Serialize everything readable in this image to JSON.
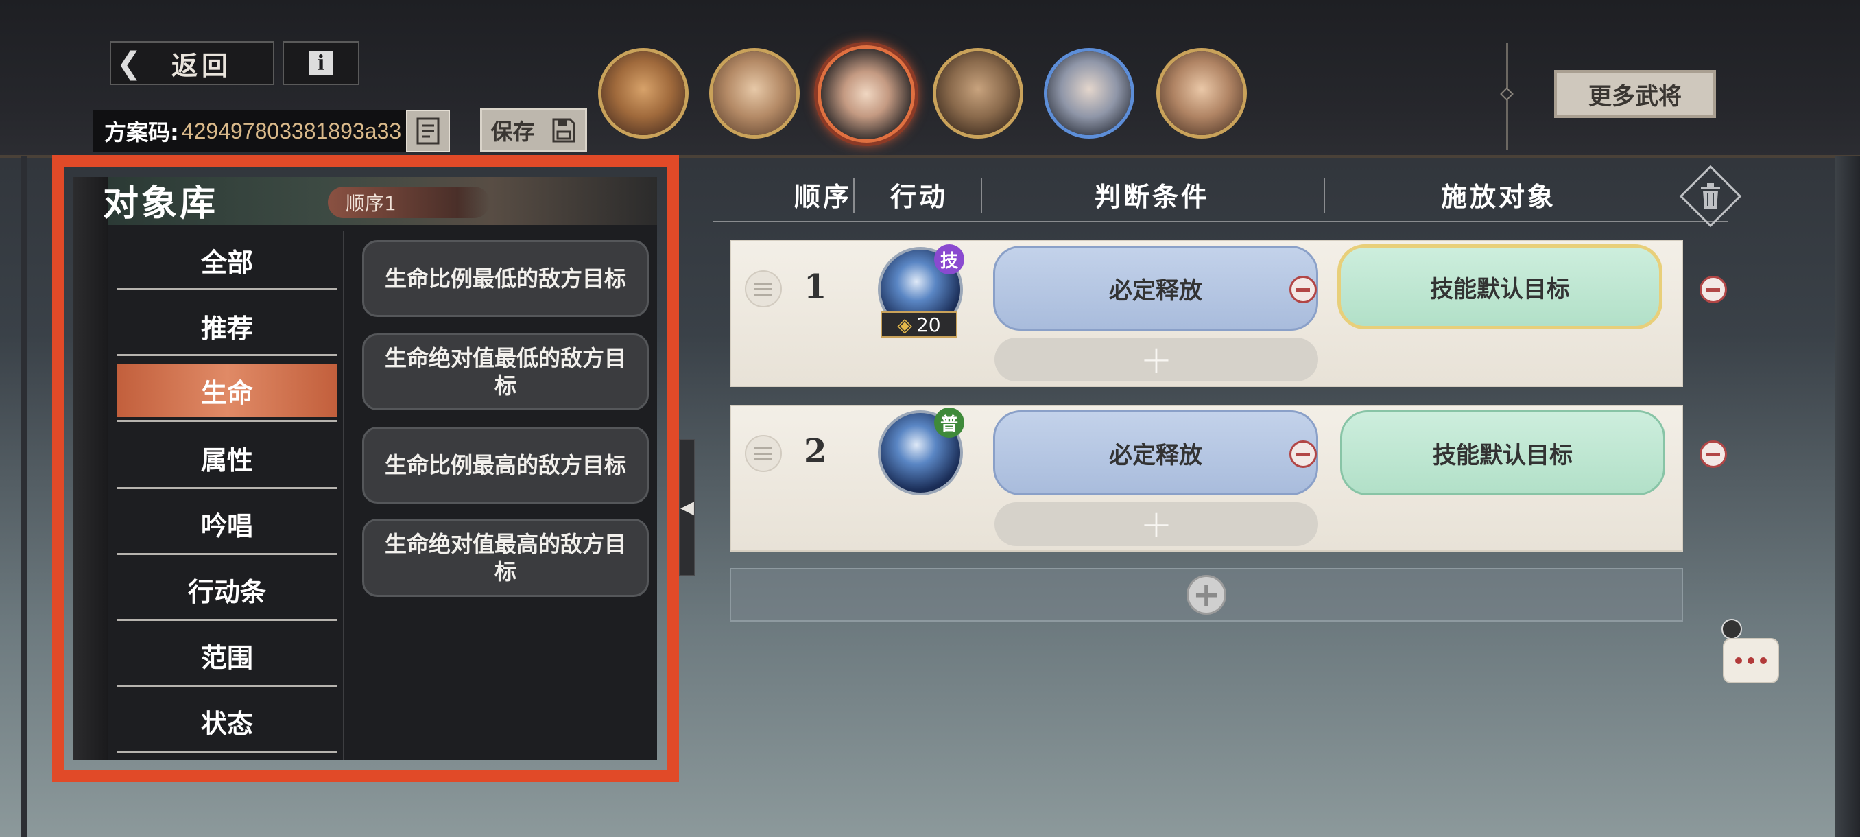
{
  "header": {
    "back_label": "返回",
    "info_label": "i",
    "scheme_key": "方案码:",
    "scheme_value": "429497803381893a33",
    "save_label": "保存",
    "more_label": "更多武将"
  },
  "avatars": [
    {
      "name": "hero-1",
      "colors": [
        "#5a3a26",
        "#d7a26a"
      ]
    },
    {
      "name": "hero-2",
      "colors": [
        "#6a4c36",
        "#e7c9a8"
      ]
    },
    {
      "name": "hero-3",
      "colors": [
        "#2e2a2a",
        "#f0d7c2"
      ]
    },
    {
      "name": "hero-4",
      "colors": [
        "#3a2a1e",
        "#c8a37e"
      ]
    },
    {
      "name": "hero-5",
      "colors": [
        "#2a2f3a",
        "#e4d6cc"
      ]
    },
    {
      "name": "hero-6",
      "colors": [
        "#5a3f2e",
        "#eac8a8"
      ]
    }
  ],
  "library": {
    "title": "对象库",
    "order_badge": "顺序1",
    "categories": [
      "全部",
      "推荐",
      "生命",
      "属性",
      "吟唱",
      "行动条",
      "范围",
      "状态"
    ],
    "selected_category": "生命",
    "targets": [
      "生命比例最低的敌方目标",
      "生命绝对值最低的敌方目标",
      "生命比例最高的敌方目标",
      "生命绝对值最高的敌方目标"
    ]
  },
  "table": {
    "headers": {
      "order": "顺序",
      "action": "行动",
      "condition": "判断条件",
      "target": "施放对象"
    },
    "rows": [
      {
        "num": "1",
        "skill_badge": "技",
        "badge_color": "#8a4ad0",
        "cost": "20",
        "condition": "必定释放",
        "target": "技能默认目标",
        "target_selected": true
      },
      {
        "num": "2",
        "skill_badge": "普",
        "badge_color": "#3f8a3a",
        "cost": "",
        "condition": "必定释放",
        "target": "技能默认目标",
        "target_selected": false
      }
    ],
    "plus_symbol": "+"
  },
  "colors": {
    "accent_outline": "#e14a28",
    "selected_category": "#d6764f"
  }
}
